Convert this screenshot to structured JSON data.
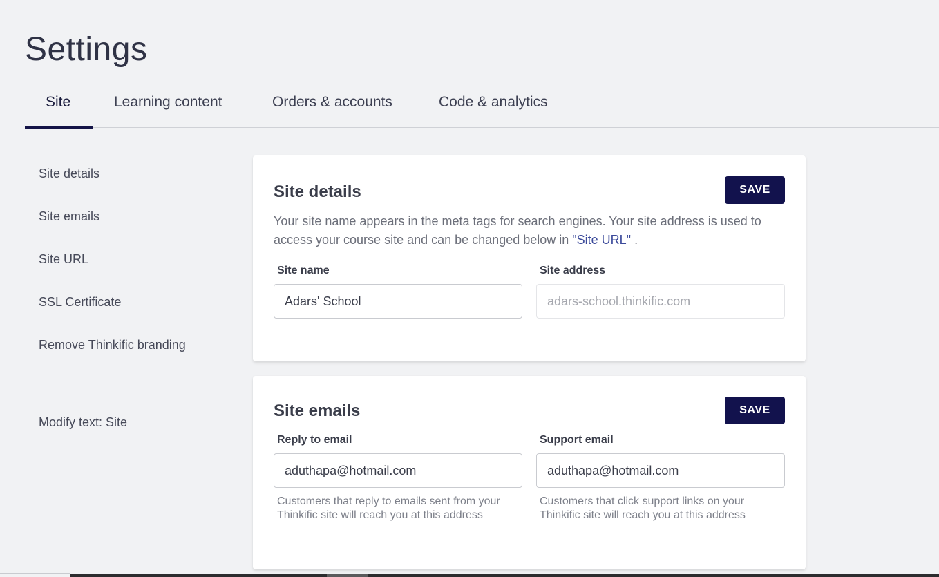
{
  "page": {
    "title": "Settings"
  },
  "tabs": [
    {
      "label": "Site",
      "active": true
    },
    {
      "label": "Learning content",
      "active": false
    },
    {
      "label": "Orders & accounts",
      "active": false
    },
    {
      "label": "Code & analytics",
      "active": false
    }
  ],
  "subnav": {
    "items": [
      {
        "label": "Site details"
      },
      {
        "label": "Site emails"
      },
      {
        "label": "Site URL"
      },
      {
        "label": "SSL Certificate"
      },
      {
        "label": "Remove Thinkific branding"
      }
    ],
    "extra_item": {
      "label": "Modify text: Site"
    }
  },
  "site_details": {
    "title": "Site details",
    "save_label": "SAVE",
    "description_pre": "Your site name appears in the meta tags for search engines. Your site address is used to access your course site and can be changed below in ",
    "description_link": "\"Site URL\"",
    "description_post": " .",
    "site_name": {
      "label": "Site name",
      "value": "Adars' School"
    },
    "site_address": {
      "label": "Site address",
      "placeholder": "adars-school.thinkific.com"
    }
  },
  "site_emails": {
    "title": "Site emails",
    "save_label": "SAVE",
    "reply_to": {
      "label": "Reply to email",
      "value": "aduthapa@hotmail.com",
      "help": "Customers that reply to emails sent from your Thinkific site will reach you at this address"
    },
    "support": {
      "label": "Support email",
      "value": "aduthapa@hotmail.com",
      "help": "Customers that click support links on your Thinkific site will reach you at this address"
    }
  },
  "colors": {
    "primary": "#12124d",
    "background": "#f1f2f4",
    "link": "#3b4a9a"
  }
}
